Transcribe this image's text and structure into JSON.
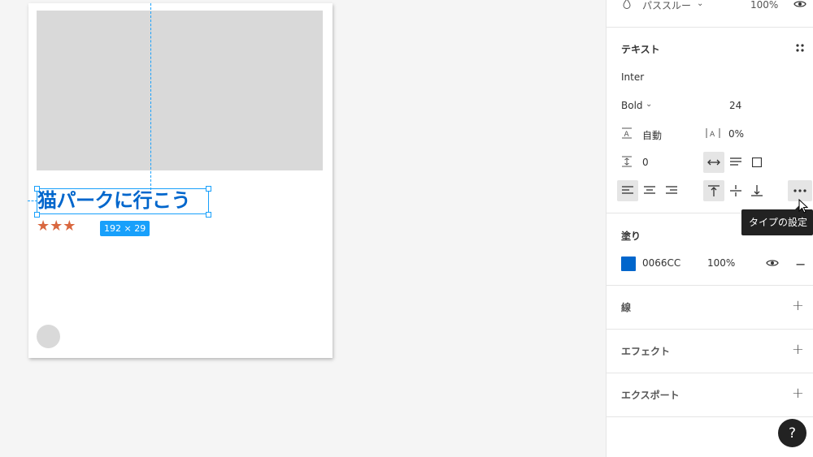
{
  "canvas": {
    "heading": "猫パークに行こう",
    "rating": "★★★",
    "size_badge": "192 × 29"
  },
  "panel": {
    "layer": {
      "blend_mode": "パススルー",
      "opacity": "100%"
    },
    "text": {
      "section_title": "テキスト",
      "font_family": "Inter",
      "font_weight": "Bold",
      "font_size": "24",
      "line_height": "自動",
      "letter_spacing": "0%",
      "paragraph_spacing": "0"
    },
    "tooltip": "タイプの設定",
    "fill": {
      "section_title": "塗り",
      "hex": "0066CC",
      "opacity": "100%",
      "color": "#0066CC"
    },
    "stroke": {
      "section_title": "線"
    },
    "effects": {
      "section_title": "エフェクト"
    },
    "export": {
      "section_title": "エクスポート"
    }
  },
  "help_label": "?"
}
